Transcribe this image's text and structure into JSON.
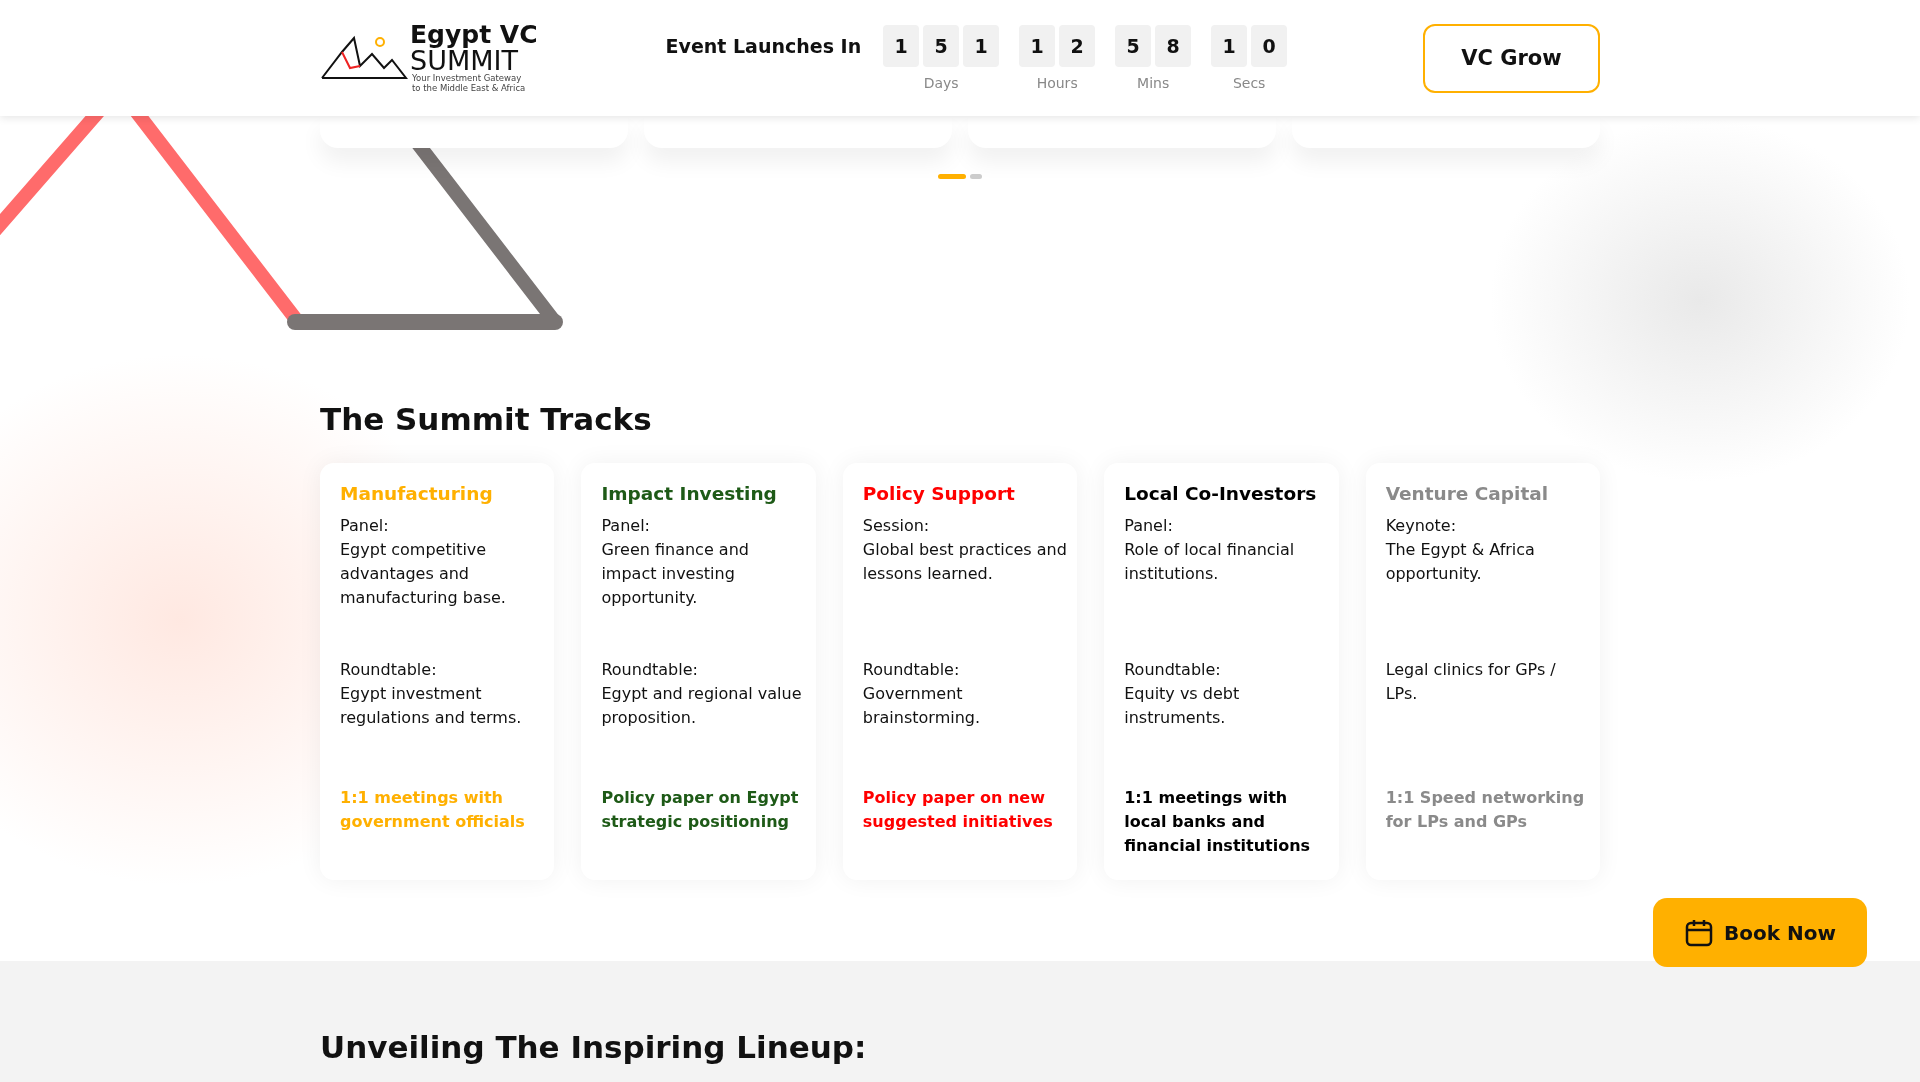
{
  "header": {
    "logo": {
      "title": "Egypt VC",
      "subtitle": "SUMMIT",
      "tagline": [
        "Your Investment Gateway",
        "to the Middle East & Africa"
      ]
    },
    "countdown": {
      "label": "Event Launches In",
      "groups": [
        {
          "digits": [
            "1",
            "5",
            "1"
          ],
          "unit": "Days"
        },
        {
          "digits": [
            "1",
            "2"
          ],
          "unit": "Hours"
        },
        {
          "digits": [
            "5",
            "8"
          ],
          "unit": "Mins"
        },
        {
          "digits": [
            "1",
            "0"
          ],
          "unit": "Secs"
        }
      ]
    },
    "button": "VC Grow"
  },
  "carousel": {
    "dots": [
      {
        "selected": true
      },
      {
        "selected": false
      }
    ]
  },
  "tracks": {
    "title": "The Summit Tracks",
    "items": [
      {
        "title": "Manufacturing",
        "color": "#ffb000",
        "blocks": [
          {
            "label": "Panel:",
            "text": "Egypt competitive advantages and manufacturing base."
          },
          {
            "label": "Roundtable:",
            "text": "Egypt investment regulations and terms."
          }
        ],
        "highlight": "1:1 meetings with government officials"
      },
      {
        "title": "Impact Investing",
        "color": "#1e5a17",
        "blocks": [
          {
            "label": "Panel:",
            "text": "Green finance and impact investing opportunity."
          },
          {
            "label": "Roundtable:",
            "text": "Egypt and regional value proposition."
          }
        ],
        "highlight": "Policy paper on Egypt strategic positioning"
      },
      {
        "title": "Policy Support",
        "color": "#ff0000",
        "blocks": [
          {
            "label": "Session:",
            "text": "Global best practices and lessons learned."
          },
          {
            "label": "Roundtable:",
            "text": "Government brainstorming."
          }
        ],
        "highlight": "Policy paper on new suggested initiatives"
      },
      {
        "title": "Local Co-Investors",
        "color": "#000000",
        "blocks": [
          {
            "label": "Panel:",
            "text": "Role of local financial institutions."
          },
          {
            "label": "Roundtable:",
            "text": "Equity vs debt instruments."
          }
        ],
        "highlight": "1:1 meetings with local banks and financial institutions"
      },
      {
        "title": "Venture Capital",
        "color": "#8a8a8a",
        "blocks": [
          {
            "label": "Keynote:",
            "text": "The Egypt & Africa opportunity."
          },
          {
            "text": "Legal clinics for GPs / LPs."
          }
        ],
        "highlight": "1:1 Speed networking for LPs and GPs"
      }
    ]
  },
  "lineup": {
    "title": "Unveiling The Inspiring Lineup:"
  },
  "book_button": "Book Now"
}
